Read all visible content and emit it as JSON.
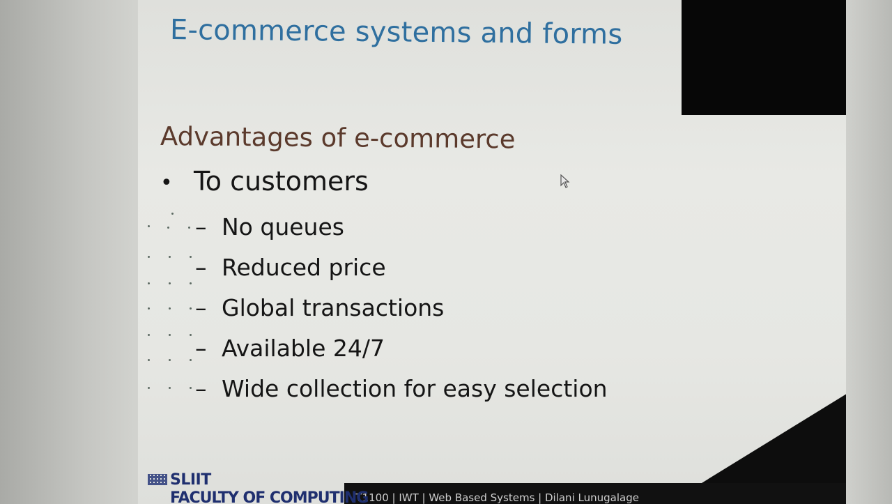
{
  "slide": {
    "title": "E-commerce systems and forms",
    "heading": "Advantages of e-commerce",
    "bullet": "To customers",
    "sub_items": [
      "No queues",
      "Reduced price",
      "Global transactions",
      "Available 24/7",
      "Wide collection for easy selection"
    ]
  },
  "footer": {
    "logo_name": "SLIIT",
    "logo_sub": "FACULTY OF COMPUTING",
    "text": "IT1100 | IWT | Web Based Systems    | Dilani Lunugalage"
  },
  "colors": {
    "title": "#2f6f9f",
    "heading": "#5b3a2c",
    "body_text": "#151515",
    "footer_bar": "#111111"
  },
  "icons": {
    "cursor": "mouse-pointer-icon",
    "bullet": "bullet-dot-icon",
    "logo": "sliit-logo-icon"
  }
}
